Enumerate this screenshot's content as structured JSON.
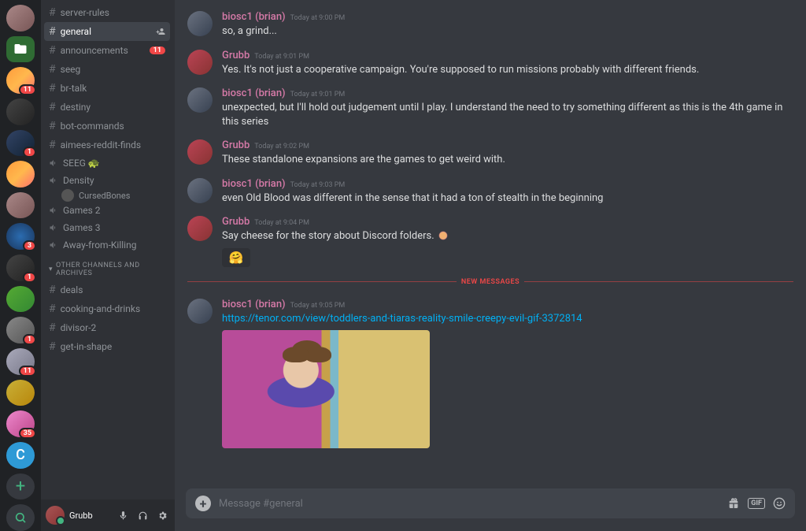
{
  "rail": {
    "servers": [
      {
        "variant": "grad6",
        "badge": null
      },
      {
        "variant": "folder",
        "badge": null
      },
      {
        "variant": "grad1",
        "badge": "11"
      },
      {
        "variant": "grad3",
        "badge": null
      },
      {
        "variant": "grad7",
        "badge": "1"
      },
      {
        "variant": "grad1",
        "badge": null
      },
      {
        "variant": "grad6",
        "badge": null
      },
      {
        "variant": "grad2",
        "badge": "3"
      },
      {
        "variant": "grad3",
        "badge": "1"
      },
      {
        "variant": "grad4",
        "badge": null
      },
      {
        "variant": "grad10",
        "badge": "1"
      },
      {
        "variant": "grad8",
        "badge": "11"
      },
      {
        "variant": "grad11",
        "badge": null
      },
      {
        "variant": "grad9",
        "badge": "35"
      }
    ],
    "letter_server": "C"
  },
  "sidebar": {
    "channels": [
      {
        "kind": "text",
        "name": "server-rules"
      },
      {
        "kind": "text",
        "name": "general",
        "active": true,
        "personAdd": true
      },
      {
        "kind": "text",
        "name": "announcements",
        "badge": "11"
      },
      {
        "kind": "text",
        "name": "seeg"
      },
      {
        "kind": "text",
        "name": "br-talk"
      },
      {
        "kind": "text",
        "name": "destiny"
      },
      {
        "kind": "text",
        "name": "bot-commands"
      },
      {
        "kind": "text",
        "name": "aimees-reddit-finds"
      },
      {
        "kind": "voice",
        "name": "SEEG",
        "emoji": "🐢"
      },
      {
        "kind": "voice",
        "name": "Density"
      },
      {
        "kind": "vcuser",
        "name": "CursedBones"
      },
      {
        "kind": "voice",
        "name": "Games 2"
      },
      {
        "kind": "voice",
        "name": "Games 3"
      },
      {
        "kind": "voice",
        "name": "Away-from-Killing"
      }
    ],
    "category_label": "OTHER CHANNELS AND ARCHIVES",
    "other_channels": [
      {
        "kind": "text",
        "name": "deals"
      },
      {
        "kind": "text",
        "name": "cooking-and-drinks"
      },
      {
        "kind": "text",
        "name": "divisor-2"
      },
      {
        "kind": "text",
        "name": "get-in-shape"
      }
    ]
  },
  "user_panel": {
    "name": "Grubb"
  },
  "messages": [
    {
      "author": "biosc1 (brian)",
      "authorClass": "pink",
      "avatar": "biosc",
      "ts": "Today at 9:00 PM",
      "text": "so, a grind..."
    },
    {
      "author": "Grubb",
      "authorClass": "pinkalt",
      "avatar": "grubb",
      "ts": "Today at 9:01 PM",
      "text": "Yes. It's not just a cooperative campaign. You're supposed to run missions probably with different friends."
    },
    {
      "author": "biosc1 (brian)",
      "authorClass": "pink",
      "avatar": "biosc",
      "ts": "Today at 9:01 PM",
      "text": "unexpected, but I'll hold out judgement until I play.  I understand the need to try something different as this is the 4th game in this series"
    },
    {
      "author": "Grubb",
      "authorClass": "pinkalt",
      "avatar": "grubb",
      "ts": "Today at 9:02 PM",
      "text": "These standalone expansions are the games to get weird with."
    },
    {
      "author": "biosc1 (brian)",
      "authorClass": "pink",
      "avatar": "biosc",
      "ts": "Today at 9:03 PM",
      "text": "even Old Blood was different in the sense that it had a ton of stealth in the beginning"
    },
    {
      "author": "Grubb",
      "authorClass": "pinkalt",
      "avatar": "grubb",
      "ts": "Today at 9:04 PM",
      "text": "Say cheese for the story about Discord folders.",
      "inlineEmoji": true,
      "reaction": "🤗"
    }
  ],
  "new_messages_label": "NEW MESSAGES",
  "after_divider": {
    "author": "biosc1 (brian)",
    "authorClass": "pink",
    "avatar": "biosc",
    "ts": "Today at 9:05 PM",
    "link": "https://tenor.com/view/toddlers-and-tiaras-reality-smile-creepy-evil-gif-3372814"
  },
  "input": {
    "placeholder": "Message #general"
  }
}
